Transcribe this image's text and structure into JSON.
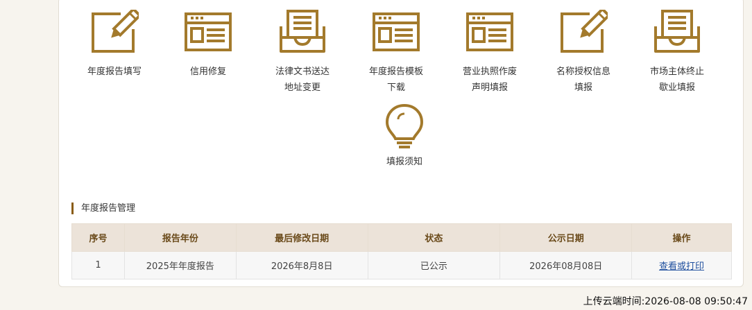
{
  "accent_color": "#a37a2c",
  "tiles": [
    {
      "icon": "edit-icon",
      "lines": [
        "年度报告填写",
        ""
      ]
    },
    {
      "icon": "window-form-icon",
      "lines": [
        "信用修复",
        ""
      ]
    },
    {
      "icon": "inbox-document-icon",
      "lines": [
        "法律文书送达",
        "地址变更"
      ]
    },
    {
      "icon": "window-form-icon",
      "lines": [
        "年度报告模板",
        "下载"
      ]
    },
    {
      "icon": "window-form-icon",
      "lines": [
        "营业执照作废",
        "声明填报"
      ]
    },
    {
      "icon": "edit-icon",
      "lines": [
        "名称授权信息",
        "填报"
      ]
    },
    {
      "icon": "inbox-document-icon",
      "lines": [
        "市场主体终止",
        "歇业填报"
      ]
    },
    {
      "icon": "lightbulb-icon",
      "lines": [
        "填报须知",
        ""
      ]
    }
  ],
  "section": {
    "title": "年度报告管理"
  },
  "table": {
    "headers": [
      "序号",
      "报告年份",
      "最后修改日期",
      "状态",
      "公示日期",
      "操作"
    ],
    "rows": [
      {
        "index": "1",
        "year": "2025年年度报告",
        "modified": "2026年8月8日",
        "status": "已公示",
        "publish_date": "2026年08月08日",
        "action": "查看或打印"
      }
    ]
  },
  "footer": {
    "upload_time": "上传云端时间:2026-08-08 09:50:47"
  }
}
